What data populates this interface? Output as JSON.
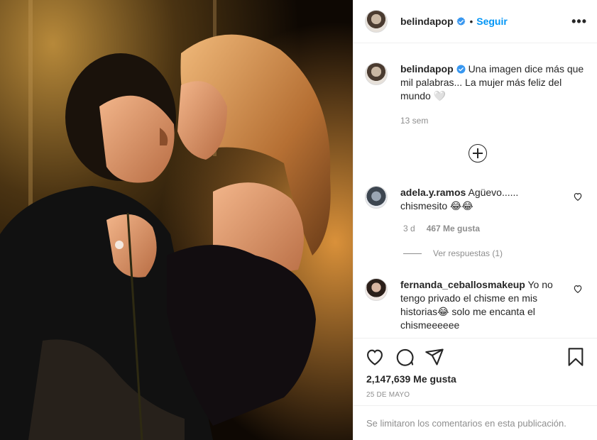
{
  "post": {
    "author": "belindapop",
    "follow_label": "Seguir",
    "more_icon": "more-horizontal-icon",
    "caption": "Una imagen dice más que mil palabras... La mujer más feliz del mundo 🤍",
    "caption_time": "13 sem"
  },
  "comments": [
    {
      "user": "adela.y.ramos",
      "text": "Agüevo...... chismesito 😂😂",
      "time": "3 d",
      "likes": "467 Me gusta",
      "view_replies": "Ver respuestas (1)"
    },
    {
      "user": "fernanda_ceballosmakeup",
      "text": "Yo no tengo privado el chisme en mis historias😂 solo me encanta el chismeeeeee"
    }
  ],
  "stats": {
    "likes": "2,147,639 Me gusta",
    "date": "25 DE MAYO"
  },
  "comments_closed": "Se limitaron los comentarios en esta publicación.",
  "colors": {
    "accent": "#0095f6",
    "text": "#262626",
    "muted": "#8e8e8e",
    "border": "#efefef"
  }
}
